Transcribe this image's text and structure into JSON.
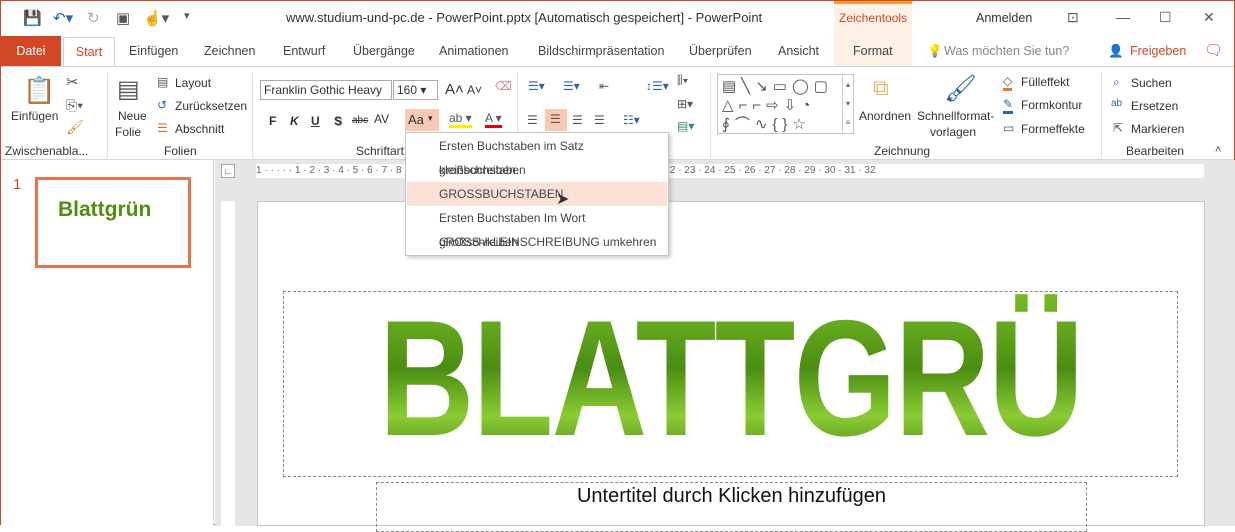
{
  "titlebar": {
    "title": "www.studium-und-pc.de  -  PowerPoint.pptx [Automatisch gespeichert]  -  PowerPoint",
    "context_tab_group": "Zeichentools",
    "sign_in": "Anmelden"
  },
  "tabs": [
    "Datei",
    "Start",
    "Einfügen",
    "Zeichnen",
    "Entwurf",
    "Übergänge",
    "Animationen",
    "Bildschirmpräsentation",
    "Überprüfen",
    "Ansicht",
    "Format"
  ],
  "tell_me": "Was möchten Sie tun?",
  "share": "Freigeben",
  "ribbon": {
    "clipboard": {
      "label": "Zwischenabla...",
      "paste": "Einfügen"
    },
    "slides": {
      "label": "Folien",
      "new_slide_1": "Neue",
      "new_slide_2": "Folie",
      "layout": "Layout",
      "reset": "Zurücksetzen",
      "section": "Abschnitt"
    },
    "font": {
      "label": "Schriftart",
      "font_name": "Franklin Gothic Heavy",
      "font_size": "160",
      "bold": "F",
      "italic": "K",
      "underline": "U",
      "shadow": "S",
      "strike": "abc",
      "spacing": "AV",
      "case": "Aa"
    },
    "drawing": {
      "label": "Zeichnung",
      "arrange": "Anordnen",
      "quick_styles_1": "Schnellformat-",
      "quick_styles_2": "vorlagen",
      "fill": "Fülleffekt",
      "outline": "Formkontur",
      "effects": "Formeffekte"
    },
    "editing": {
      "label": "Bearbeiten",
      "find": "Suchen",
      "replace": "Ersetzen",
      "select": "Markieren"
    }
  },
  "case_menu": {
    "items": [
      "Ersten Buchstaben im Satz großschreiben.",
      "kleinbuchstaben",
      "GROSSBUCHSTABEN",
      "Ersten Buchstaben Im Wort Großschreiben",
      "gROSS-/kLEINSCHREIBUNG umkehren"
    ],
    "highlighted": 2
  },
  "thumbnails": [
    {
      "number": "1",
      "text": "Blattgrün"
    }
  ],
  "ruler": "1 · · · · · 1 · 2 · 3 · 4 · 5 · 6 · 7 · 8 · 9 · 10 · 11 · 12 · 13 · 14 · 15 · 16 · 17 · 18 · 19 · 20 · 21 · 22 · 23 · 24 · 25 · 26 · 27 · 28 · 29 · 30 · 31 · 32",
  "slide": {
    "title": "BLATTGRÜN",
    "subtitle_placeholder": "Untertitel durch Klicken hinzufügen"
  },
  "colors": {
    "accent": "#d24726",
    "highlight": "#f8c9b3",
    "text_green": "#5a9e1b"
  }
}
